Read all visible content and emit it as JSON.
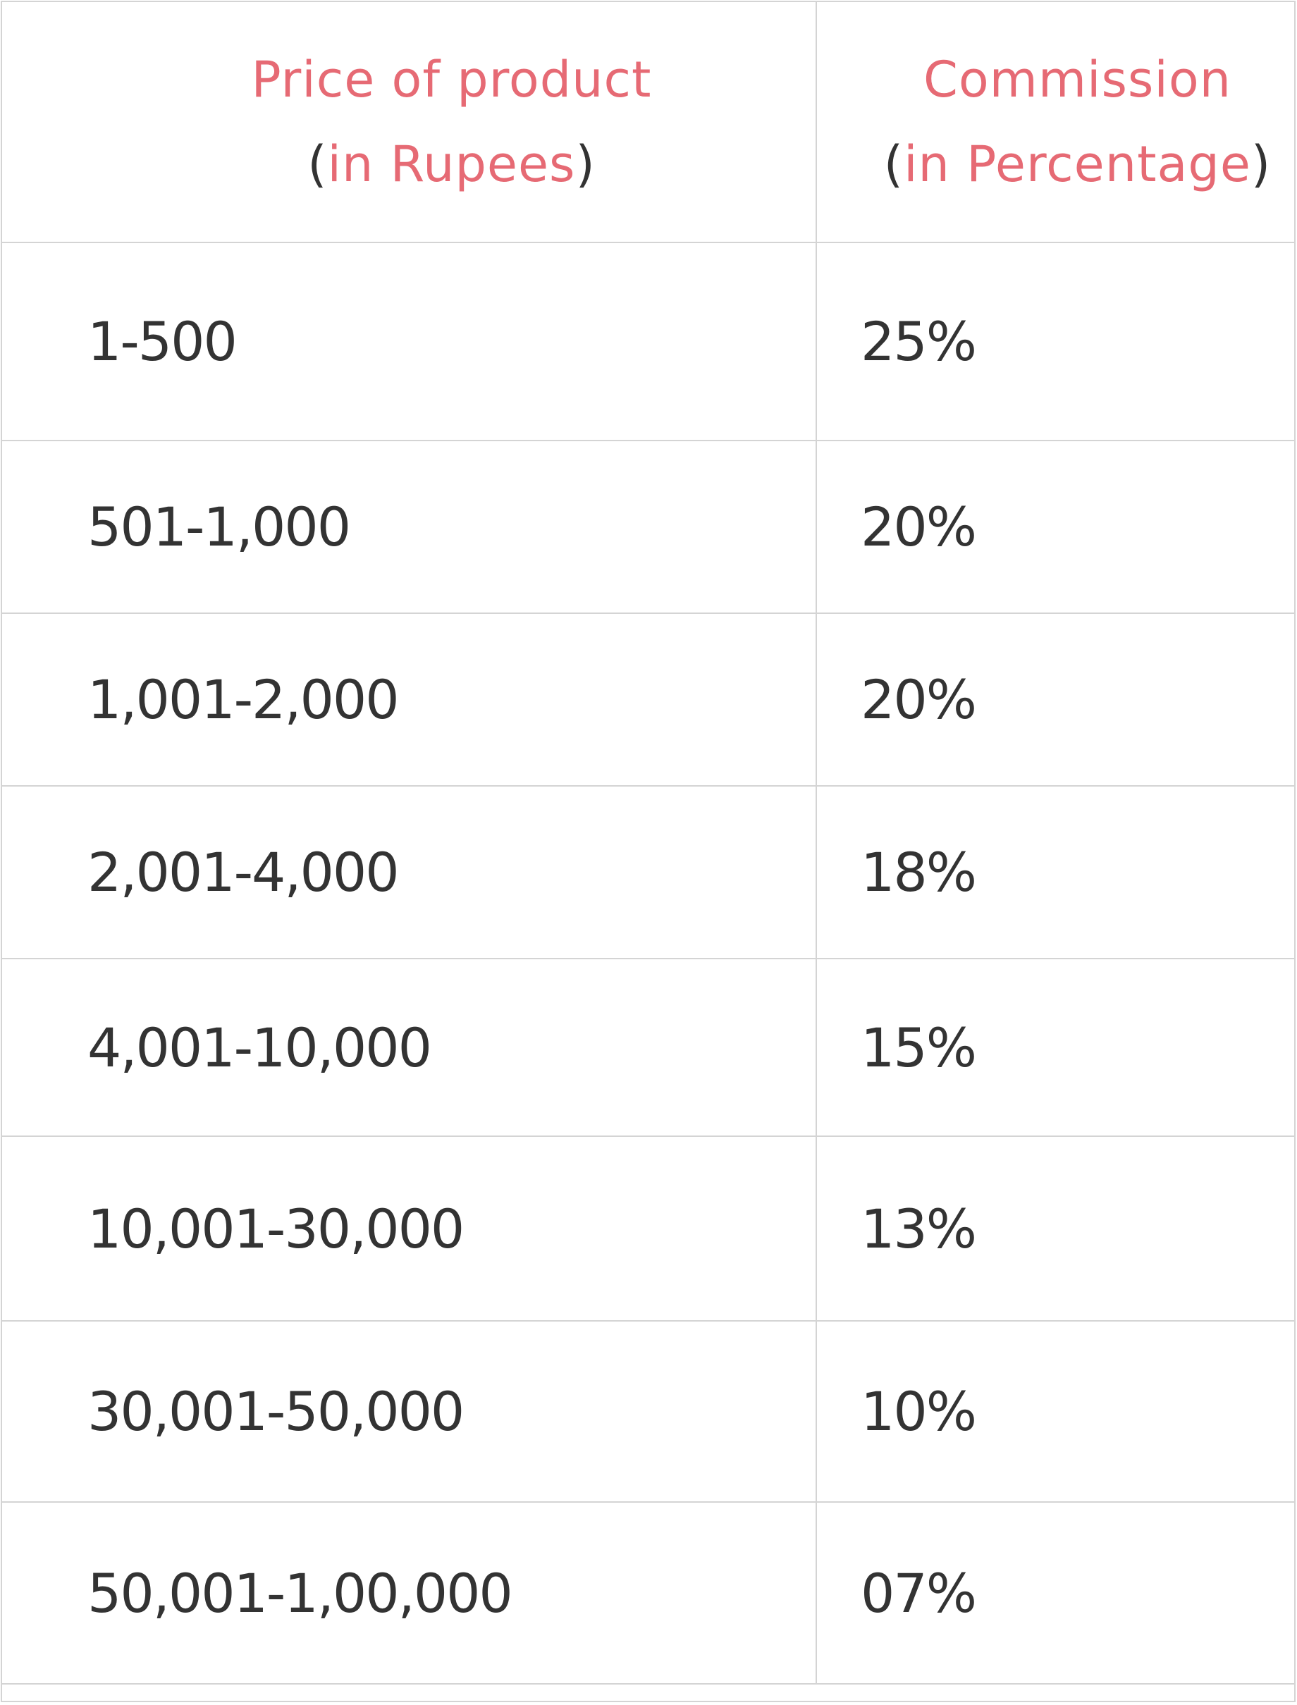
{
  "table": {
    "headers": [
      {
        "title": "Price of product",
        "paren_open": "(",
        "unit": "in Rupees",
        "paren_close": ")"
      },
      {
        "title": "Commission",
        "paren_open": "(",
        "unit": "in Percentage",
        "paren_close": ")"
      }
    ],
    "rows": [
      {
        "price": "1-500",
        "commission": "25%"
      },
      {
        "price": "501-1,000",
        "commission": "20%"
      },
      {
        "price": "1,001-2,000",
        "commission": "20%"
      },
      {
        "price": "2,001-4,000",
        "commission": "18%"
      },
      {
        "price": "4,001-10,000",
        "commission": "15%"
      },
      {
        "price": "10,001-30,000",
        "commission": "13%"
      },
      {
        "price": "30,001-50,000",
        "commission": "10%"
      },
      {
        "price": "50,001-1,00,000",
        "commission": "07%"
      }
    ]
  }
}
